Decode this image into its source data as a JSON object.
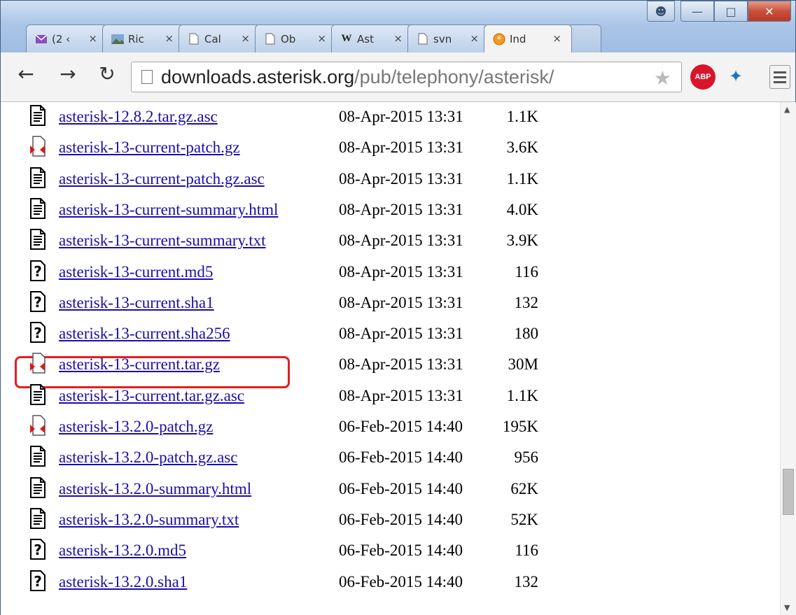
{
  "browser": {
    "tabs": [
      {
        "title": "(2 ‹",
        "icon": "mail-icon"
      },
      {
        "title": "Ric",
        "icon": "image-icon"
      },
      {
        "title": "Cal",
        "icon": "page-icon"
      },
      {
        "title": "Ob",
        "icon": "page-icon"
      },
      {
        "title": "Ast",
        "icon": "wikipedia-icon"
      },
      {
        "title": "svn",
        "icon": "page-icon"
      },
      {
        "title": "Ind",
        "icon": "asterisk-icon",
        "active": true
      }
    ],
    "close_glyph": "×",
    "url_host": "downloads.asterisk.org",
    "url_path": "/pub/telephony/asterisk/",
    "abp_label": "ABP"
  },
  "files": [
    {
      "name": "asterisk-12.8.2.tar.gz.asc",
      "date": "08-Apr-2015 13:31",
      "size": "1.1K",
      "icon": "text-file-icon"
    },
    {
      "name": "asterisk-13-current-patch.gz",
      "date": "08-Apr-2015 13:31",
      "size": "3.6K",
      "icon": "archive-file-icon"
    },
    {
      "name": "asterisk-13-current-patch.gz.asc",
      "date": "08-Apr-2015 13:31",
      "size": "1.1K",
      "icon": "text-file-icon"
    },
    {
      "name": "asterisk-13-current-summary.html",
      "date": "08-Apr-2015 13:31",
      "size": "4.0K",
      "icon": "text-file-icon"
    },
    {
      "name": "asterisk-13-current-summary.txt",
      "date": "08-Apr-2015 13:31",
      "size": "3.9K",
      "icon": "text-file-icon"
    },
    {
      "name": "asterisk-13-current.md5",
      "date": "08-Apr-2015 13:31",
      "size": "116",
      "icon": "unknown-file-icon"
    },
    {
      "name": "asterisk-13-current.sha1",
      "date": "08-Apr-2015 13:31",
      "size": "132",
      "icon": "unknown-file-icon"
    },
    {
      "name": "asterisk-13-current.sha256",
      "date": "08-Apr-2015 13:31",
      "size": "180",
      "icon": "unknown-file-icon"
    },
    {
      "name": "asterisk-13-current.tar.gz",
      "date": "08-Apr-2015 13:31",
      "size": "30M",
      "icon": "archive-file-icon",
      "highlighted": true
    },
    {
      "name": "asterisk-13-current.tar.gz.asc",
      "date": "08-Apr-2015 13:31",
      "size": "1.1K",
      "icon": "text-file-icon"
    },
    {
      "name": "asterisk-13.2.0-patch.gz",
      "date": "06-Feb-2015 14:40",
      "size": "195K",
      "icon": "archive-file-icon"
    },
    {
      "name": "asterisk-13.2.0-patch.gz.asc",
      "date": "06-Feb-2015 14:40",
      "size": "956",
      "icon": "text-file-icon"
    },
    {
      "name": "asterisk-13.2.0-summary.html",
      "date": "06-Feb-2015 14:40",
      "size": "62K",
      "icon": "text-file-icon"
    },
    {
      "name": "asterisk-13.2.0-summary.txt",
      "date": "06-Feb-2015 14:40",
      "size": "52K",
      "icon": "text-file-icon"
    },
    {
      "name": "asterisk-13.2.0.md5",
      "date": "06-Feb-2015 14:40",
      "size": "116",
      "icon": "unknown-file-icon"
    },
    {
      "name": "asterisk-13.2.0.sha1",
      "date": "06-Feb-2015 14:40",
      "size": "132",
      "icon": "unknown-file-icon"
    }
  ],
  "colors": {
    "link": "#1a0dab",
    "highlight_border": "#e02020"
  }
}
